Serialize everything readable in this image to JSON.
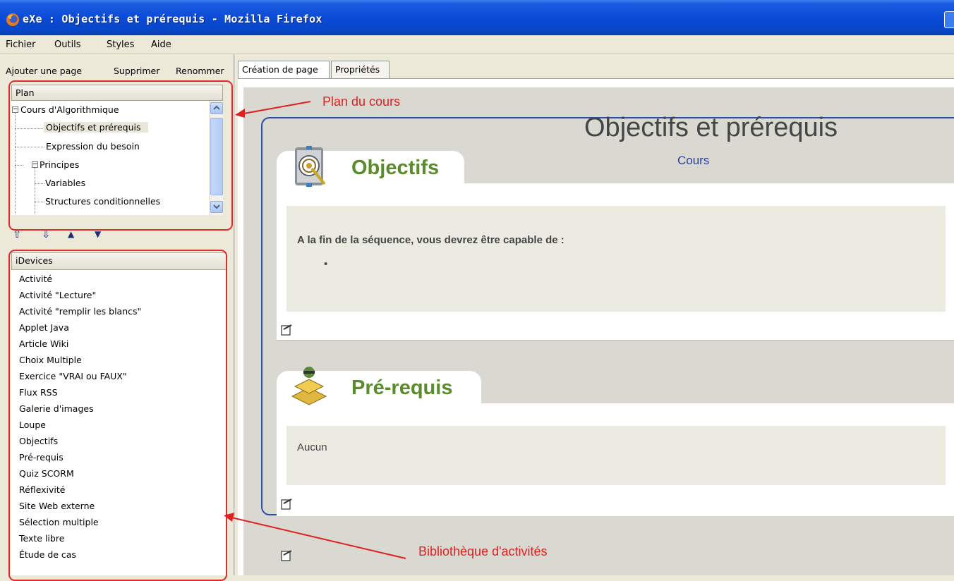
{
  "window": {
    "title": "eXe : Objectifs et prérequis - Mozilla Firefox"
  },
  "menu": {
    "fichier": "Fichier",
    "outils": "Outils",
    "styles": "Styles",
    "aide": "Aide"
  },
  "outline_toolbar": {
    "add": "Ajouter une page",
    "delete": "Supprimer",
    "rename": "Renommer"
  },
  "outline": {
    "header": "Plan",
    "nodes": [
      {
        "label": "Cours d'Algorithmique"
      },
      {
        "label": "Objectifs et prérequis"
      },
      {
        "label": "Expression du besoin"
      },
      {
        "label": "Principes"
      },
      {
        "label": "Variables"
      },
      {
        "label": "Structures conditionnelles"
      }
    ]
  },
  "idevices": {
    "header": "iDevices",
    "items": [
      "Activité",
      "Activité \"Lecture\"",
      "Activité \"remplir les blancs\"",
      "Applet Java",
      "Article Wiki",
      "Choix Multiple",
      "Exercice \"VRAI ou FAUX\"",
      "Flux RSS",
      "Galerie d'images",
      "Loupe",
      "Objectifs",
      "Pré-requis",
      "Quiz SCORM",
      "Réflexivité",
      "Site Web externe",
      "Sélection multiple",
      "Texte libre",
      "Étude de cas"
    ]
  },
  "tabs": {
    "creation": "Création de page",
    "properties": "Propriétés"
  },
  "page": {
    "title": "Objectifs et prérequis",
    "subtitle": "Cours",
    "blocks": [
      {
        "title": "Objectifs",
        "text": "A la fin de la séquence, vous devrez être capable de :",
        "bullet": "•"
      },
      {
        "title": "Pré-requis",
        "text": "Aucun"
      }
    ]
  },
  "annotations": {
    "plan": "Plan du cours",
    "library": "Bibliothèque d'activités"
  },
  "colors": {
    "accent_red": "#e12a2a",
    "title_green": "#5a8b2c",
    "frame_blue": "#2a4bb0"
  }
}
